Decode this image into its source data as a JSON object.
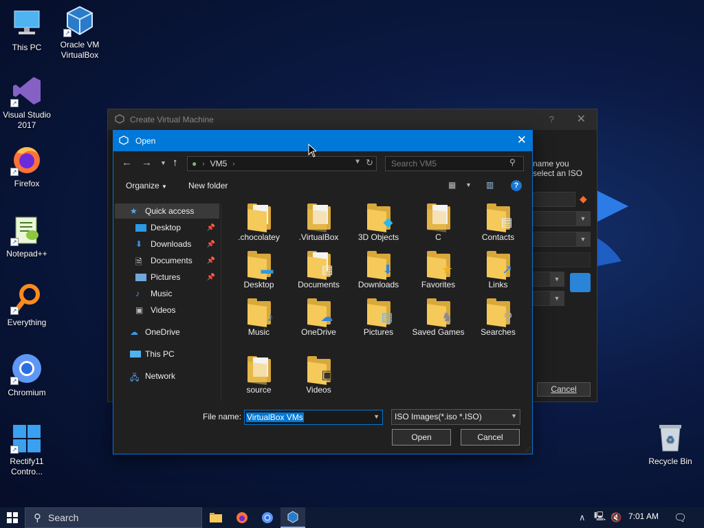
{
  "desktop": {
    "icons": [
      {
        "label": "This PC"
      },
      {
        "label": "Oracle VM VirtualBox"
      },
      {
        "label": "Visual Studio 2017"
      },
      {
        "label": "Firefox"
      },
      {
        "label": "Notepad++"
      },
      {
        "label": "Everything"
      },
      {
        "label": "Chromium"
      },
      {
        "label": "Rectify11 Contro..."
      },
      {
        "label": "Recycle Bin"
      }
    ]
  },
  "bg_dialog": {
    "title": "Create Virtual Machine",
    "help": "?",
    "side_text_1": "name you",
    "side_text_2": "select an ISO",
    "cancel_label": "Cancel"
  },
  "open_dialog": {
    "title": "Open",
    "address": {
      "segment": "VM5"
    },
    "search": {
      "placeholder": "Search VM5"
    },
    "toolbar": {
      "organize": "Organize",
      "new_folder": "New folder"
    },
    "nav": [
      {
        "label": "Quick access",
        "icon": "star-icon",
        "selected": true
      },
      {
        "label": "Desktop",
        "icon": "desktop-icon",
        "pinned": true
      },
      {
        "label": "Downloads",
        "icon": "download-icon",
        "pinned": true
      },
      {
        "label": "Documents",
        "icon": "document-icon",
        "pinned": true
      },
      {
        "label": "Pictures",
        "icon": "picture-icon",
        "pinned": true
      },
      {
        "label": "Music",
        "icon": "music-icon"
      },
      {
        "label": "Videos",
        "icon": "video-icon"
      },
      {
        "label": "OneDrive",
        "icon": "cloud-icon"
      },
      {
        "label": "This PC",
        "icon": "computer-icon"
      },
      {
        "label": "Network",
        "icon": "network-icon"
      }
    ],
    "files": [
      {
        "name": ".chocolatey"
      },
      {
        "name": ".VirtualBox"
      },
      {
        "name": "3D Objects"
      },
      {
        "name": "C"
      },
      {
        "name": "Contacts"
      },
      {
        "name": "Desktop"
      },
      {
        "name": "Documents"
      },
      {
        "name": "Downloads"
      },
      {
        "name": "Favorites"
      },
      {
        "name": "Links"
      },
      {
        "name": "Music"
      },
      {
        "name": "OneDrive"
      },
      {
        "name": "Pictures"
      },
      {
        "name": "Saved Games"
      },
      {
        "name": "Searches"
      },
      {
        "name": "source"
      },
      {
        "name": "Videos"
      }
    ],
    "file_name_label": "File name:",
    "file_name_value": "VirtualBox VMs",
    "filter_value": "ISO Images(*.iso *.ISO)",
    "open_label": "Open",
    "cancel_label": "Cancel"
  },
  "taskbar": {
    "search_label": "Search",
    "clock": "7:01 AM"
  },
  "colors": {
    "accent": "#0078d7",
    "folder": "#f5c95a"
  }
}
